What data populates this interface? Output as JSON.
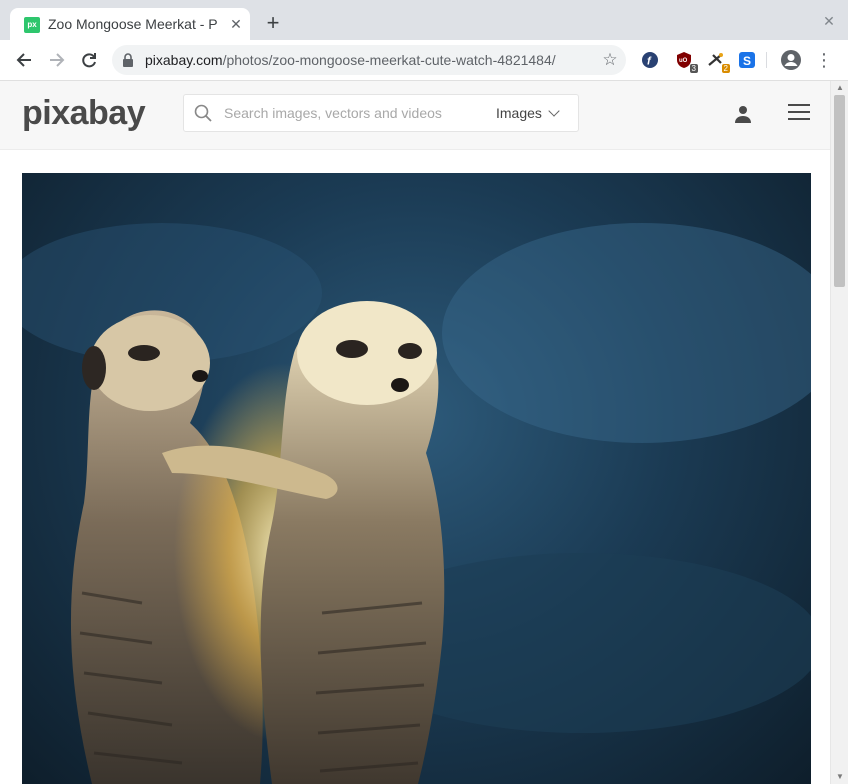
{
  "browser": {
    "tab_title": "Zoo Mongoose Meerkat - P",
    "favicon_text": "px",
    "new_tab_icon": "plus-icon",
    "close_icon": "close-icon",
    "url_domain": "pixabay.com",
    "url_path": "/photos/zoo-mongoose-meerkat-cute-watch-4821484/",
    "extensions": [
      {
        "name": "fedora-extension-icon",
        "badge": ""
      },
      {
        "name": "ublock-extension-icon",
        "badge": "3"
      },
      {
        "name": "tool-extension-icon",
        "badge": "2"
      },
      {
        "name": "s-extension-icon",
        "badge": ""
      }
    ]
  },
  "site": {
    "logo": "pixabay",
    "search": {
      "placeholder": "Search images, vectors and videos",
      "type": "Images"
    }
  },
  "photo": {
    "subject": "two meerkats embracing"
  }
}
